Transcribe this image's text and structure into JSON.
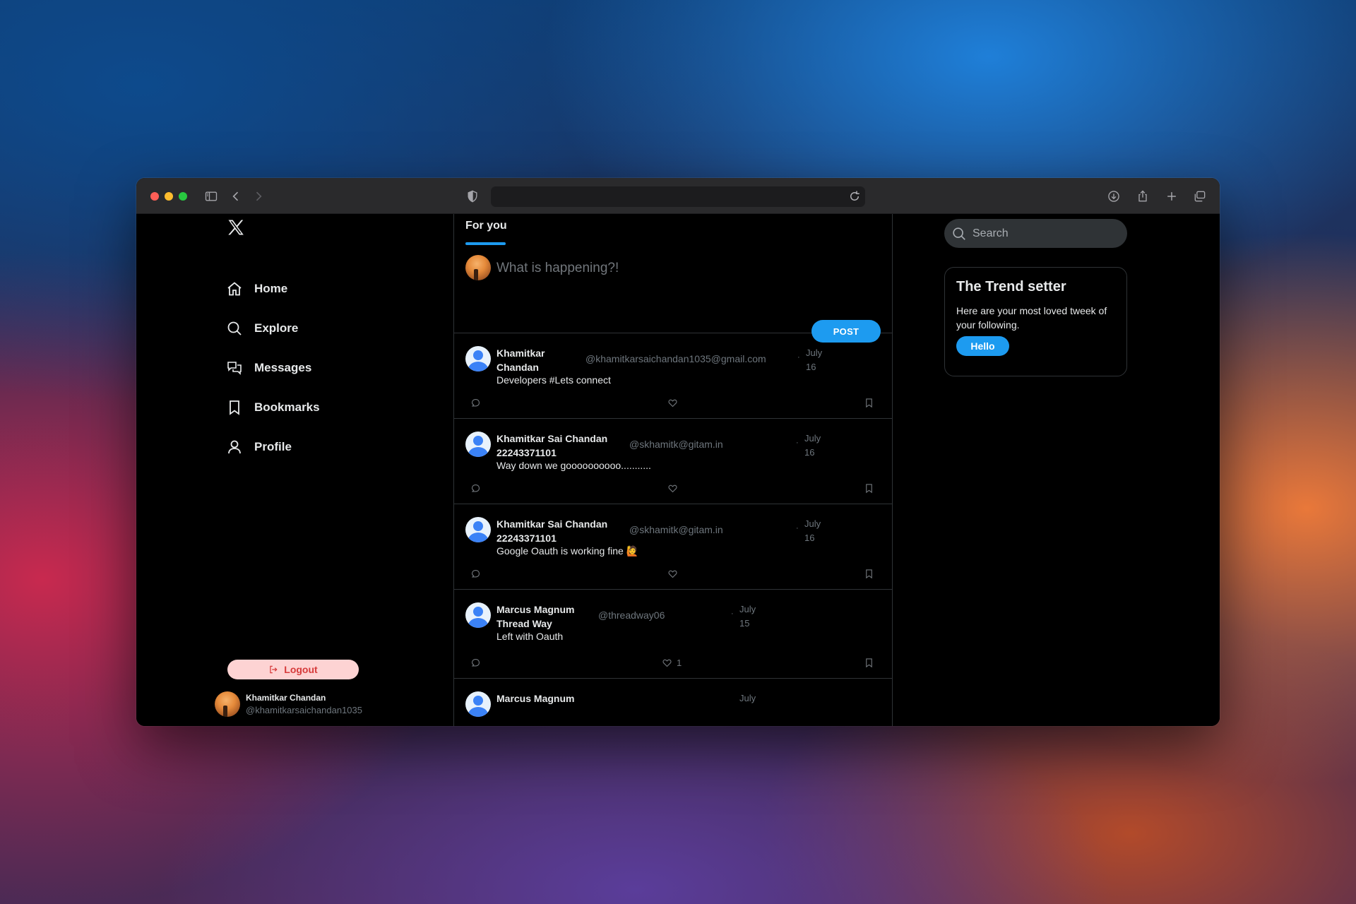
{
  "browser": {
    "url": ""
  },
  "sidebar": {
    "items": [
      {
        "label": "Home",
        "icon": "home-icon"
      },
      {
        "label": "Explore",
        "icon": "search-icon"
      },
      {
        "label": "Messages",
        "icon": "messages-icon"
      },
      {
        "label": "Bookmarks",
        "icon": "bookmark-icon"
      },
      {
        "label": "Profile",
        "icon": "profile-icon"
      }
    ],
    "logout_label": "Logout",
    "user": {
      "name": "Khamitkar Chandan",
      "handle": "@khamitkarsaichandan1035"
    }
  },
  "feed": {
    "tab_label": "For you",
    "compose_placeholder": "What is happening?!",
    "post_label": "POST",
    "tweets": [
      {
        "name": "Khamitkar Chandan",
        "handle": "@khamitkarsaichandan1035@gmail.com",
        "date": "July 16",
        "text": "Developers #Lets connect",
        "likes": ""
      },
      {
        "name": "Khamitkar Sai Chandan 22243371101",
        "handle": "@skhamitk@gitam.in",
        "date": "July 16",
        "text": "Way down we goooooooooo...........",
        "likes": ""
      },
      {
        "name": "Khamitkar Sai Chandan 22243371101",
        "handle": "@skhamitk@gitam.in",
        "date": "July 16",
        "text": "Google Oauth is working fine 🙋",
        "likes": ""
      },
      {
        "name": "Marcus Magnum Thread Way",
        "handle": "@threadway06",
        "date": "July 15",
        "text": "Left with Oauth",
        "likes": "1"
      },
      {
        "name": "Marcus Magnum",
        "handle": "",
        "date": "July",
        "text": "",
        "likes": ""
      }
    ]
  },
  "right": {
    "search_placeholder": "Search",
    "trend": {
      "title": "The Trend setter",
      "text": "Here are your most loved tweek of your following.",
      "button": "Hello"
    }
  },
  "colors": {
    "accent": "#1d9bf0",
    "logout_bg": "#fdd3d3",
    "logout_text": "#d63b3b"
  }
}
